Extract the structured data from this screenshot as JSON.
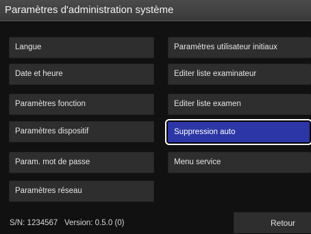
{
  "title": "Paramètres d'administration système",
  "left_buttons": [
    "Langue",
    "Date et heure",
    "Paramètres fonction",
    "Paramètres dispositif",
    "Param. mot de passe",
    "Paramètres réseau"
  ],
  "right_buttons": [
    "Paramètres utilisateur initiaux",
    "Editer liste examinateur",
    "Editer liste examen",
    "Suppression auto",
    "Menu service"
  ],
  "selected_item": "Suppression auto",
  "footer": {
    "serial": "S/N: 1234567",
    "version": "Version: 0.5.0 (0)",
    "back_label": "Retour"
  },
  "colors": {
    "selected_fill": "#2c36a6",
    "selected_border": "#ffffff",
    "button_bg": "#2e2e2e",
    "background": "#111111"
  }
}
